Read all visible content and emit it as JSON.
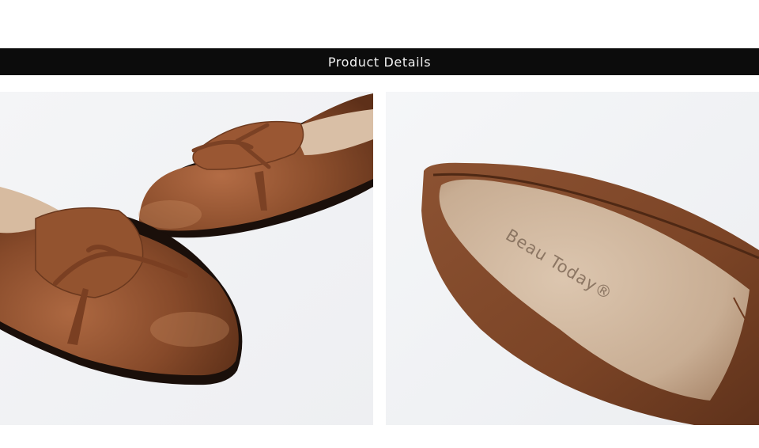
{
  "header": {
    "title": "Product Details"
  },
  "photos": [
    {
      "subject": "pair-of-brown-leather-tassel-loafers"
    },
    {
      "subject": "brown-loafer-insole-closeup",
      "insole_brand": "Beau Today®"
    }
  ],
  "colors": {
    "banner_bg": "#0c0c0c",
    "banner_text": "#f2f2f2",
    "leather": "#8a4d2c",
    "insole": "#cdb49c"
  }
}
